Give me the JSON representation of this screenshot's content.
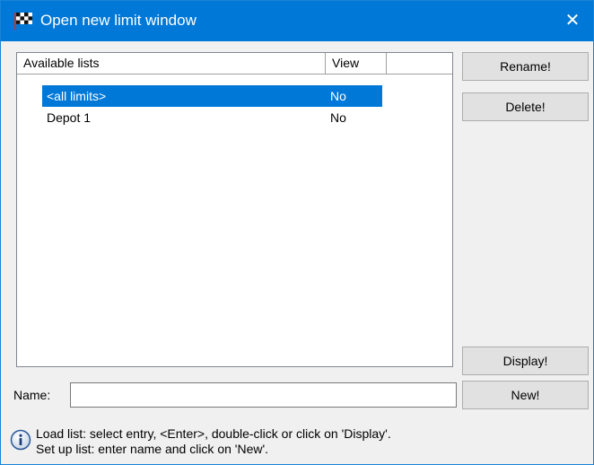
{
  "window": {
    "title": "Open new limit window",
    "close_symbol": "✕"
  },
  "list": {
    "columns": [
      "Available lists",
      "View"
    ],
    "rows": [
      {
        "name": "<all limits>",
        "view": "No",
        "selected": true
      },
      {
        "name": "Depot 1",
        "view": "No",
        "selected": false
      }
    ]
  },
  "buttons": {
    "rename": "Rename!",
    "delete": "Delete!",
    "display": "Display!",
    "new": "New!"
  },
  "name_field": {
    "label": "Name:",
    "value": ""
  },
  "help": {
    "line1": "Load list: select entry, <Enter>, double-click or click on 'Display'.",
    "line2": "Set up list: enter name and click on 'New'."
  },
  "icons": {
    "title": "checkered-flag-icon",
    "info": "info-icon",
    "close": "close-icon"
  },
  "colors": {
    "titlebar": "#0078d7",
    "selection": "#0078d7",
    "dialog_bg": "#f0f0f0"
  }
}
